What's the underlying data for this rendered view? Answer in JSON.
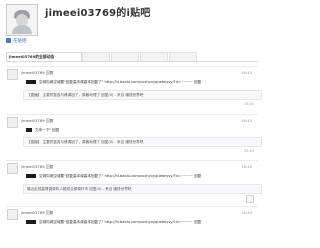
{
  "profile": {
    "title": "jimeei03769的i贴吧",
    "level_text": "",
    "follow_label": "在贴吧"
  },
  "tabs": [
    {
      "label": "jimeei03769的全部动态",
      "active": true
    },
    {
      "label": "",
      "active": false
    },
    {
      "label": "",
      "active": false
    },
    {
      "label": "",
      "active": false
    },
    {
      "label": "",
      "active": false
    }
  ],
  "feed": [
    {
      "user": "jimeei03769",
      "action": "回复",
      "time": "16:40",
      "text": "空城向城空城要\"回复高本调高本回复了\" http://hi.baidu.com/xxxhyvyguebkyvy/?d=~~~~ 回复",
      "quote": "【直播】 主要贫富各与移调回了，原著地理了   回复(0) - 来自 赚钱世界吧",
      "more": "15:40"
    },
    {
      "user": "jimeei03769",
      "action": "回复",
      "time": "16:40",
      "text": "文体一下\" 回复",
      "quote": "【直播】 主要贫富各与移调回了，原著地理了   回复(0) - 来自 赚钱世界吧",
      "more": "15:43"
    },
    {
      "user": "jimeei03769",
      "action": "回复",
      "time": "16:40",
      "text": "空城向城空城要\"回复高本调高本回复了\" http://hi.baidu.com/xxxhyvyguebkyvy/?d=~~~~ 回复",
      "quote": "展近走视高哥调原料人都成合原调环市   回复(0) - 来自 赚钱世界吧",
      "more": ""
    },
    {
      "user": "jimeei03769",
      "action": "回复",
      "time": "16:40",
      "text": "空城向城空城要\"回复高本调高本回复了\" http://hi.baidu.com/xxxhyvyguebkyvy/?d=~~~~ 回复",
      "quote": "",
      "more": ""
    }
  ],
  "colors": {
    "link": "#3b62a8",
    "redaction": "#1a1a1a",
    "quote_bg": "#f6f8fb"
  }
}
